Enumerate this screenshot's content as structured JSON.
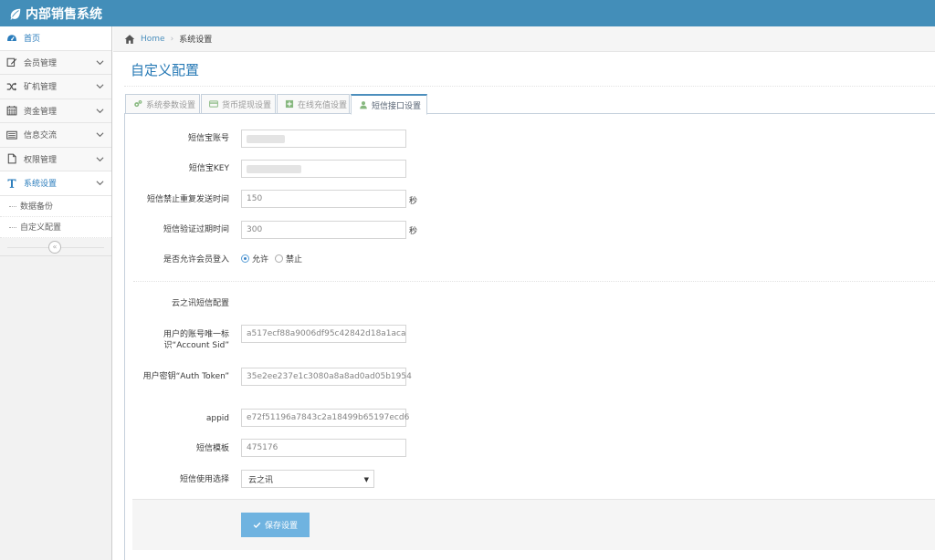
{
  "app": {
    "title": "内部销售系统"
  },
  "sidebar": {
    "items": [
      {
        "label": "首页",
        "icon": "dashboard-icon"
      },
      {
        "label": "会员管理",
        "icon": "edit-icon"
      },
      {
        "label": "矿机管理",
        "icon": "random-icon"
      },
      {
        "label": "资金管理",
        "icon": "calendar-icon"
      },
      {
        "label": "信息交流",
        "icon": "list-icon"
      },
      {
        "label": "权限管理",
        "icon": "file-icon"
      },
      {
        "label": "系统设置",
        "icon": "text-icon"
      }
    ],
    "sub_items": [
      {
        "label": "数据备份"
      },
      {
        "label": "自定义配置"
      }
    ],
    "collapse_glyph": "«"
  },
  "breadcrumb": {
    "home": "Home",
    "current": "系统设置"
  },
  "page": {
    "title": "自定义配置"
  },
  "tabs": [
    {
      "label": "系统参数设置",
      "icon": "cogs-icon"
    },
    {
      "label": "货币提现设置",
      "icon": "credit-card-icon"
    },
    {
      "label": "在线充值设置",
      "icon": "plus-square-icon"
    },
    {
      "label": "短信接口设置",
      "icon": "user-icon"
    }
  ],
  "form": {
    "sms_account": {
      "label": "短信宝账号"
    },
    "sms_key": {
      "label": "短信宝KEY"
    },
    "resend_interval": {
      "label": "短信禁止重复发送时间",
      "value": "150",
      "unit": "秒"
    },
    "expire_time": {
      "label": "短信验证过期时间",
      "value": "300",
      "unit": "秒"
    },
    "allow_login": {
      "label": "是否允许会员登入",
      "options": [
        "允许",
        "禁止"
      ],
      "selected": "允许"
    },
    "section_title": "云之讯短信配置",
    "account_sid": {
      "label": "用户的账号唯一标识“Account Sid”",
      "value": "a517ecf88a9006df95c42842d18a1aca"
    },
    "auth_token": {
      "label": "用户密钥“Auth Token”",
      "value": "35e2ee237e1c3080a8a8ad0ad05b1954"
    },
    "appid": {
      "label": "appid",
      "value": "e72f51196a7843c2a18499b65197ecd6"
    },
    "template": {
      "label": "短信模板",
      "value": "475176"
    },
    "provider": {
      "label": "短信使用选择",
      "value": "云之讯"
    },
    "save_label": "保存设置"
  },
  "colors": {
    "topbar": "#438eb9",
    "link": "#4c8fbd",
    "title": "#2679b5",
    "button": "#6fb3e0"
  }
}
